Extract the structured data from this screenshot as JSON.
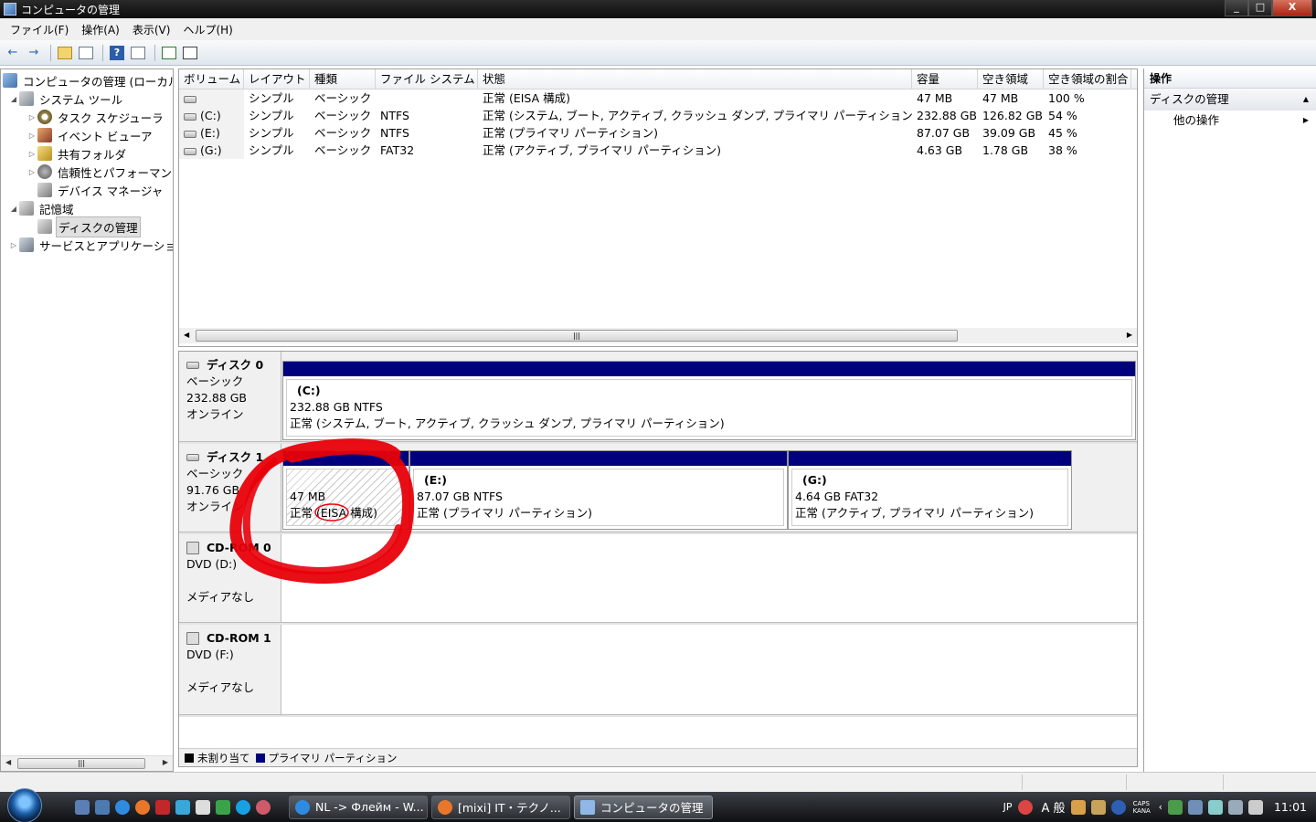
{
  "window": {
    "title": "コンピュータの管理",
    "min": "_",
    "max": "□",
    "close": "X"
  },
  "menu": [
    "ファイル(F)",
    "操作(A)",
    "表示(V)",
    "ヘルプ(H)"
  ],
  "toolbar": {
    "back": "←",
    "forward": "→",
    "help": "?"
  },
  "tree": {
    "items": [
      {
        "label": "コンピュータの管理 (ローカル)",
        "level": 0,
        "arrow": "",
        "icon": "computer-icon"
      },
      {
        "label": "システム ツール",
        "level": 1,
        "arrow": "◢",
        "icon": "tools-icon"
      },
      {
        "label": "タスク スケジューラ",
        "level": 2,
        "arrow": "▷",
        "icon": "clock-icon"
      },
      {
        "label": "イベント ビューア",
        "level": 2,
        "arrow": "▷",
        "icon": "event-viewer-icon"
      },
      {
        "label": "共有フォルダ",
        "level": 2,
        "arrow": "▷",
        "icon": "shared-folder-icon"
      },
      {
        "label": "信頼性とパフォーマンス",
        "level": 2,
        "arrow": "▷",
        "icon": "performance-icon"
      },
      {
        "label": "デバイス マネージャ",
        "level": 2,
        "arrow": "",
        "icon": "device-manager-icon"
      },
      {
        "label": "記憶域",
        "level": 1,
        "arrow": "◢",
        "icon": "storage-icon"
      },
      {
        "label": "ディスクの管理",
        "level": 2,
        "arrow": "",
        "icon": "disk-management-icon",
        "selected": true
      },
      {
        "label": "サービスとアプリケーション",
        "level": 1,
        "arrow": "▷",
        "icon": "services-icon"
      }
    ]
  },
  "volumes": {
    "columns": [
      "ボリューム",
      "レイアウト",
      "種類",
      "ファイル システム",
      "状態",
      "容量",
      "空き領域",
      "空き領域の割合",
      ""
    ],
    "rows": [
      {
        "volume": "",
        "layout": "シンプル",
        "type": "ベーシック",
        "fs": "",
        "status": "正常 (EISA 構成)",
        "capacity": "47 MB",
        "free": "47 MB",
        "pct": "100 %"
      },
      {
        "volume": "(C:)",
        "layout": "シンプル",
        "type": "ベーシック",
        "fs": "NTFS",
        "status": "正常 (システム, ブート, アクティブ, クラッシュ ダンプ, プライマリ パーティション)",
        "capacity": "232.88 GB",
        "free": "126.82 GB",
        "pct": "54 %"
      },
      {
        "volume": "(E:)",
        "layout": "シンプル",
        "type": "ベーシック",
        "fs": "NTFS",
        "status": "正常 (プライマリ パーティション)",
        "capacity": "87.07 GB",
        "free": "39.09 GB",
        "pct": "45 %"
      },
      {
        "volume": "(G:)",
        "layout": "シンプル",
        "type": "ベーシック",
        "fs": "FAT32",
        "status": "正常 (アクティブ, プライマリ パーティション)",
        "capacity": "4.63 GB",
        "free": "1.78 GB",
        "pct": "38 %"
      }
    ]
  },
  "disks": {
    "disk0": {
      "name": "ディスク 0",
      "type": "ベーシック",
      "size": "232.88 GB",
      "state": "オンライン",
      "p1": {
        "name": "(C:)",
        "size": "232.88 GB NTFS",
        "status": "正常 (システム, ブート, アクティブ, クラッシュ ダンプ, プライマリ パーティション)"
      }
    },
    "disk1": {
      "name": "ディスク 1",
      "type": "ベーシック",
      "size": "91.76 GB",
      "state": "オンライン",
      "p1": {
        "size": "47 MB",
        "status": "正常 (EISA 構成)"
      },
      "p2": {
        "name": "(E:)",
        "size": "87.07 GB NTFS",
        "status": "正常 (プライマリ パーティション)"
      },
      "p3": {
        "name": "(G:)",
        "size": "4.64 GB FAT32",
        "status": "正常 (アクティブ, プライマリ パーティション)"
      }
    },
    "cd0": {
      "name": "CD-ROM 0",
      "drive": "DVD (D:)",
      "media": "メディアなし"
    },
    "cd1": {
      "name": "CD-ROM 1",
      "drive": "DVD (F:)",
      "media": "メディアなし"
    }
  },
  "legend": {
    "unallocated": "未割り当て",
    "primary": "プライマリ パーティション",
    "unallocated_color": "#000000",
    "primary_color": "#00007f"
  },
  "actions": {
    "header": "操作",
    "section": "ディスクの管理",
    "section_arrow": "▲",
    "other": "他の操作",
    "other_arrow": "▶"
  },
  "taskbar": {
    "buttons": [
      "NL -> Флейм - W...",
      "[mixi] IT・テクノ...",
      "コンピュータの管理"
    ],
    "lang": "JP",
    "ime": "A 般",
    "caps": "CAPS KANA",
    "clock": "11:01"
  },
  "colors": {
    "primary_partition": "#00007f",
    "annotation": "#e8000a"
  }
}
